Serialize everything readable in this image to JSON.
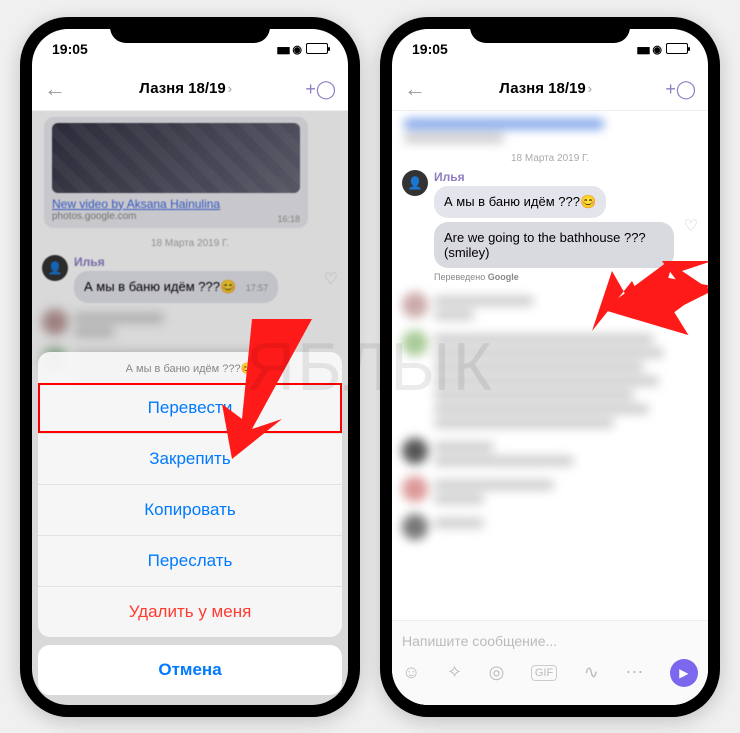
{
  "watermark": "ЯБЛЫК",
  "status": {
    "time": "19:05"
  },
  "chat": {
    "title": "Лазня 18/19",
    "date_separator": "18 Марта 2019 Г.",
    "link_card": {
      "title": "New video by Aksana Hainulina",
      "subtitle": "photos.google.com",
      "time": "16:18"
    },
    "message": {
      "author": "Илья",
      "text": "А мы в баню идём ???",
      "emoji": "😊",
      "time": "17:57"
    },
    "translation": {
      "text": "Are we going to the bathhouse ??? (smiley)",
      "credit_prefix": "Переведено ",
      "credit_brand": "Google"
    }
  },
  "sheet": {
    "preview_text": "А мы в баню идём ???",
    "items": {
      "translate": "Перевести",
      "pin": "Закрепить",
      "copy": "Копировать",
      "forward": "Переслать",
      "delete": "Удалить у меня"
    },
    "cancel": "Отмена"
  },
  "composer": {
    "placeholder": "Напишите сообщение..."
  }
}
